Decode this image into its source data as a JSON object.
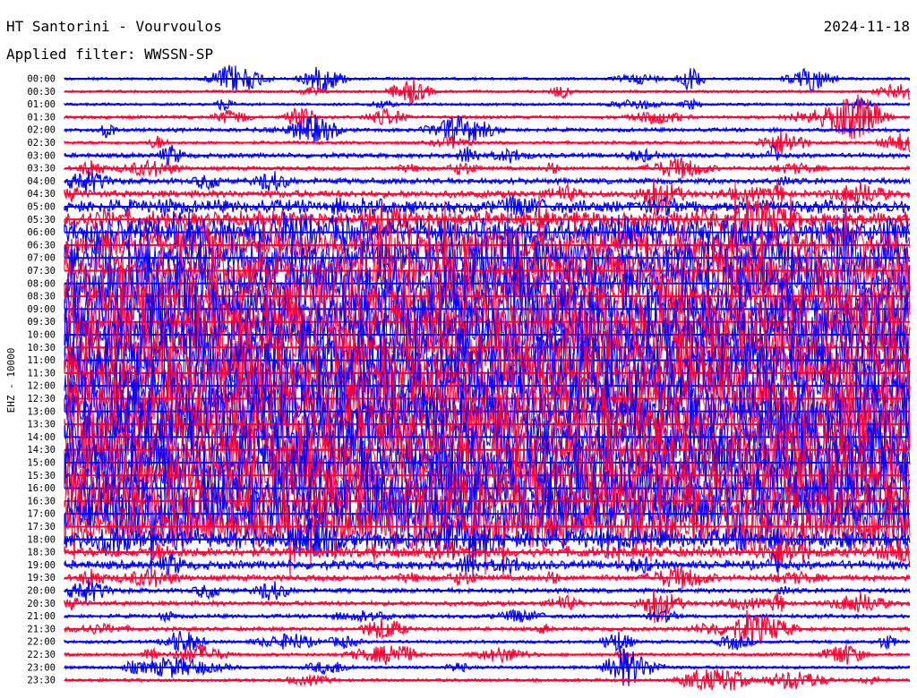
{
  "header": {
    "station": "HT Santorini - Vourvoulos",
    "date": "2024-11-18",
    "filter": "Applied filter: WWSSN-SP"
  },
  "chart_data": {
    "type": "line",
    "title": "HT Santorini - Vourvoulos",
    "ylabel": "EHZ - 10000",
    "colors": [
      "#0000ff",
      "#ff0033"
    ],
    "trace_labels": [
      "00:00",
      "00:30",
      "01:00",
      "01:30",
      "02:00",
      "02:30",
      "03:00",
      "03:30",
      "04:00",
      "04:30",
      "05:00",
      "05:30",
      "06:00",
      "06:30",
      "07:00",
      "07:30",
      "08:00",
      "08:30",
      "09:00",
      "09:30",
      "10:00",
      "10:30",
      "11:00",
      "11:30",
      "12:00",
      "12:30",
      "13:00",
      "13:30",
      "14:00",
      "14:30",
      "15:00",
      "15:30",
      "16:00",
      "16:30",
      "17:00",
      "17:30",
      "18:00",
      "18:30",
      "19:00",
      "19:30",
      "20:00",
      "20:30",
      "21:00",
      "21:30",
      "22:00",
      "22:30",
      "23:00",
      "23:30"
    ],
    "activity_level": [
      0.2,
      0.2,
      0.2,
      0.25,
      0.3,
      0.25,
      0.35,
      0.3,
      0.4,
      0.45,
      0.6,
      0.65,
      0.8,
      0.85,
      0.9,
      0.9,
      0.95,
      0.95,
      1.0,
      1.0,
      1.0,
      1.0,
      1.0,
      1.0,
      1.0,
      1.0,
      1.0,
      1.0,
      1.0,
      1.0,
      1.0,
      1.0,
      1.0,
      1.0,
      1.0,
      0.95,
      0.7,
      0.55,
      0.5,
      0.4,
      0.35,
      0.35,
      0.3,
      0.3,
      0.25,
      0.25,
      0.25,
      0.25
    ]
  }
}
